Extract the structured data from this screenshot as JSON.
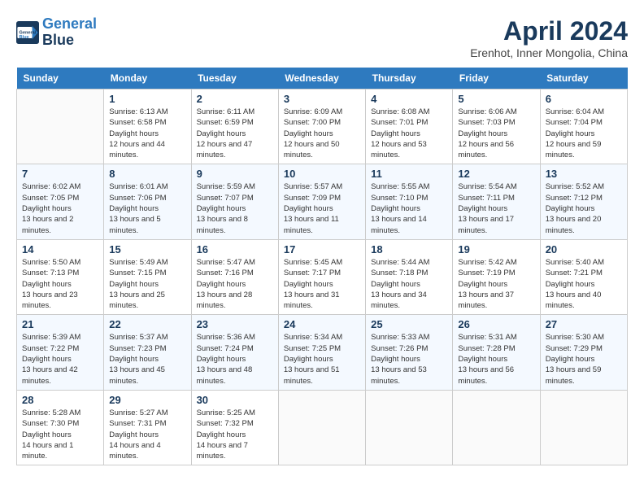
{
  "header": {
    "logo_line1": "General",
    "logo_line2": "Blue",
    "month": "April 2024",
    "location": "Erenhot, Inner Mongolia, China"
  },
  "weekdays": [
    "Sunday",
    "Monday",
    "Tuesday",
    "Wednesday",
    "Thursday",
    "Friday",
    "Saturday"
  ],
  "weeks": [
    [
      {
        "day": "",
        "empty": true
      },
      {
        "day": "1",
        "sunrise": "6:13 AM",
        "sunset": "6:58 PM",
        "daylight": "12 hours and 44 minutes."
      },
      {
        "day": "2",
        "sunrise": "6:11 AM",
        "sunset": "6:59 PM",
        "daylight": "12 hours and 47 minutes."
      },
      {
        "day": "3",
        "sunrise": "6:09 AM",
        "sunset": "7:00 PM",
        "daylight": "12 hours and 50 minutes."
      },
      {
        "day": "4",
        "sunrise": "6:08 AM",
        "sunset": "7:01 PM",
        "daylight": "12 hours and 53 minutes."
      },
      {
        "day": "5",
        "sunrise": "6:06 AM",
        "sunset": "7:03 PM",
        "daylight": "12 hours and 56 minutes."
      },
      {
        "day": "6",
        "sunrise": "6:04 AM",
        "sunset": "7:04 PM",
        "daylight": "12 hours and 59 minutes."
      }
    ],
    [
      {
        "day": "7",
        "sunrise": "6:02 AM",
        "sunset": "7:05 PM",
        "daylight": "13 hours and 2 minutes."
      },
      {
        "day": "8",
        "sunrise": "6:01 AM",
        "sunset": "7:06 PM",
        "daylight": "13 hours and 5 minutes."
      },
      {
        "day": "9",
        "sunrise": "5:59 AM",
        "sunset": "7:07 PM",
        "daylight": "13 hours and 8 minutes."
      },
      {
        "day": "10",
        "sunrise": "5:57 AM",
        "sunset": "7:09 PM",
        "daylight": "13 hours and 11 minutes."
      },
      {
        "day": "11",
        "sunrise": "5:55 AM",
        "sunset": "7:10 PM",
        "daylight": "13 hours and 14 minutes."
      },
      {
        "day": "12",
        "sunrise": "5:54 AM",
        "sunset": "7:11 PM",
        "daylight": "13 hours and 17 minutes."
      },
      {
        "day": "13",
        "sunrise": "5:52 AM",
        "sunset": "7:12 PM",
        "daylight": "13 hours and 20 minutes."
      }
    ],
    [
      {
        "day": "14",
        "sunrise": "5:50 AM",
        "sunset": "7:13 PM",
        "daylight": "13 hours and 23 minutes."
      },
      {
        "day": "15",
        "sunrise": "5:49 AM",
        "sunset": "7:15 PM",
        "daylight": "13 hours and 25 minutes."
      },
      {
        "day": "16",
        "sunrise": "5:47 AM",
        "sunset": "7:16 PM",
        "daylight": "13 hours and 28 minutes."
      },
      {
        "day": "17",
        "sunrise": "5:45 AM",
        "sunset": "7:17 PM",
        "daylight": "13 hours and 31 minutes."
      },
      {
        "day": "18",
        "sunrise": "5:44 AM",
        "sunset": "7:18 PM",
        "daylight": "13 hours and 34 minutes."
      },
      {
        "day": "19",
        "sunrise": "5:42 AM",
        "sunset": "7:19 PM",
        "daylight": "13 hours and 37 minutes."
      },
      {
        "day": "20",
        "sunrise": "5:40 AM",
        "sunset": "7:21 PM",
        "daylight": "13 hours and 40 minutes."
      }
    ],
    [
      {
        "day": "21",
        "sunrise": "5:39 AM",
        "sunset": "7:22 PM",
        "daylight": "13 hours and 42 minutes."
      },
      {
        "day": "22",
        "sunrise": "5:37 AM",
        "sunset": "7:23 PM",
        "daylight": "13 hours and 45 minutes."
      },
      {
        "day": "23",
        "sunrise": "5:36 AM",
        "sunset": "7:24 PM",
        "daylight": "13 hours and 48 minutes."
      },
      {
        "day": "24",
        "sunrise": "5:34 AM",
        "sunset": "7:25 PM",
        "daylight": "13 hours and 51 minutes."
      },
      {
        "day": "25",
        "sunrise": "5:33 AM",
        "sunset": "7:26 PM",
        "daylight": "13 hours and 53 minutes."
      },
      {
        "day": "26",
        "sunrise": "5:31 AM",
        "sunset": "7:28 PM",
        "daylight": "13 hours and 56 minutes."
      },
      {
        "day": "27",
        "sunrise": "5:30 AM",
        "sunset": "7:29 PM",
        "daylight": "13 hours and 59 minutes."
      }
    ],
    [
      {
        "day": "28",
        "sunrise": "5:28 AM",
        "sunset": "7:30 PM",
        "daylight": "14 hours and 1 minute."
      },
      {
        "day": "29",
        "sunrise": "5:27 AM",
        "sunset": "7:31 PM",
        "daylight": "14 hours and 4 minutes."
      },
      {
        "day": "30",
        "sunrise": "5:25 AM",
        "sunset": "7:32 PM",
        "daylight": "14 hours and 7 minutes."
      },
      {
        "day": "",
        "empty": true
      },
      {
        "day": "",
        "empty": true
      },
      {
        "day": "",
        "empty": true
      },
      {
        "day": "",
        "empty": true
      }
    ]
  ],
  "labels": {
    "sunrise": "Sunrise:",
    "sunset": "Sunset:",
    "daylight": "Daylight hours"
  }
}
